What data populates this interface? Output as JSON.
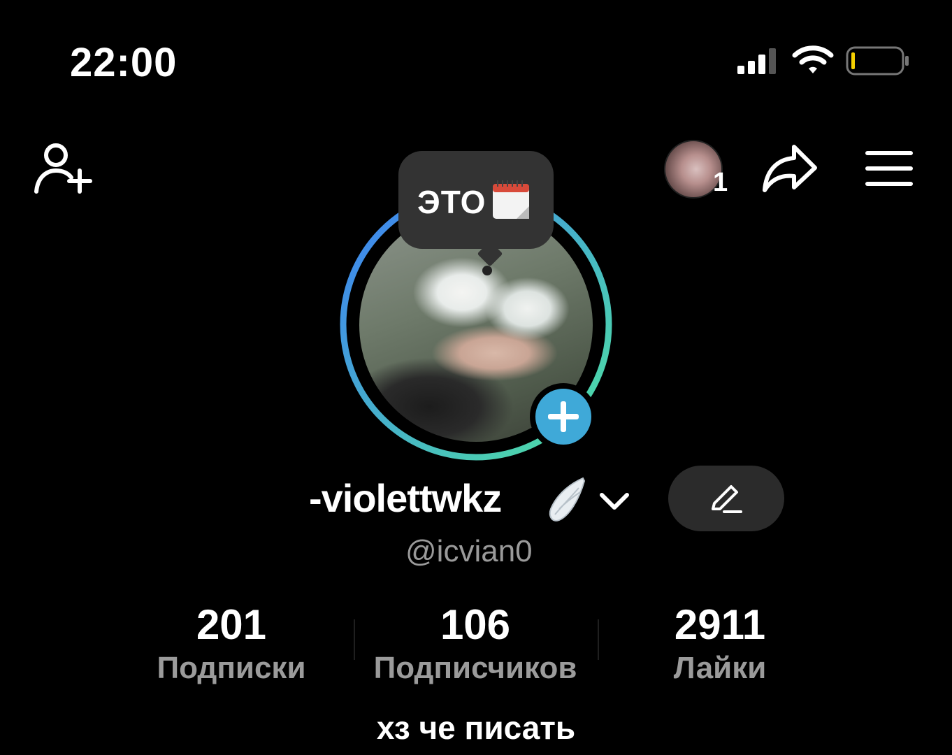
{
  "status_bar": {
    "time": "22:00"
  },
  "header": {
    "friend_count": "1"
  },
  "bubble": {
    "text": "ЭТО"
  },
  "profile": {
    "display_name": "-violettwkz",
    "username": "@icvian0",
    "bio": "хз че писать"
  },
  "stats": [
    {
      "value": "201",
      "label": "Подписки"
    },
    {
      "value": "106",
      "label": "Подписчиков"
    },
    {
      "value": "2911",
      "label": "Лайки"
    }
  ],
  "colors": {
    "ring_start": "#3d7ef5",
    "ring_end": "#4fe3a0",
    "story_plus": "#3fa9d8",
    "secondary_text": "#9b9b9b"
  }
}
